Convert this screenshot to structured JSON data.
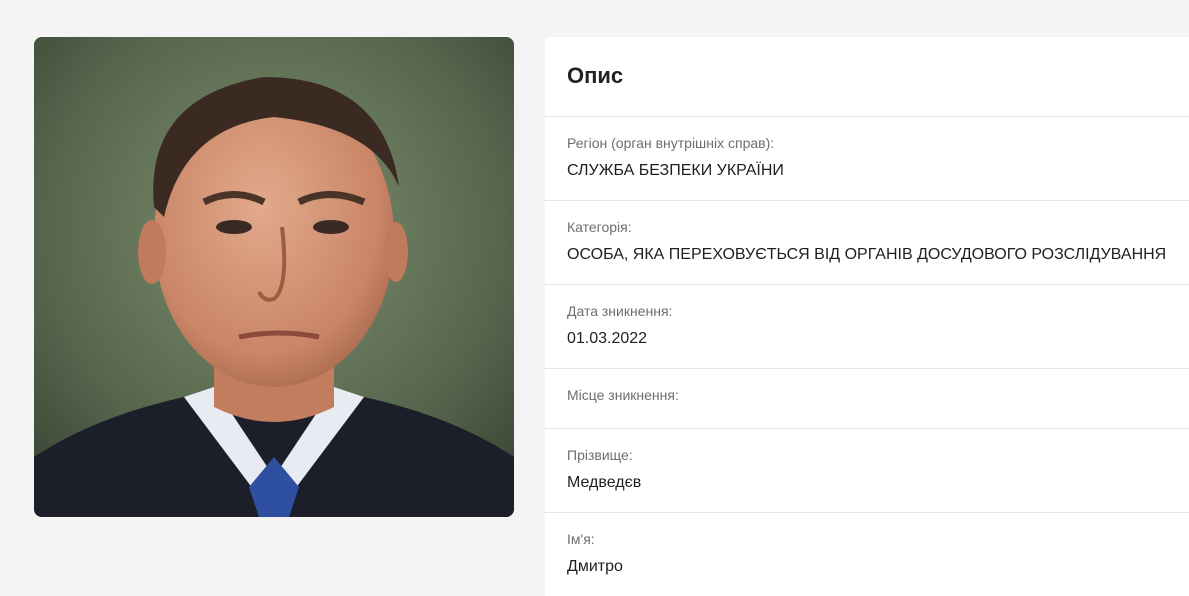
{
  "photo": {
    "description_icon": "person-portrait-photo"
  },
  "details": {
    "title": "Опис",
    "fields": [
      {
        "label": "Регіон (орган внутрішніх справ):",
        "value": "СЛУЖБА БЕЗПЕКИ УКРАЇНИ"
      },
      {
        "label": "Категорія:",
        "value": "ОСОБА, ЯКА ПЕРЕХОВУЄТЬСЯ ВІД ОРГАНІВ ДОСУДОВОГО РОЗСЛІДУВАННЯ"
      },
      {
        "label": "Дата зникнення:",
        "value": "01.03.2022"
      },
      {
        "label": "Місце зникнення:",
        "value": ""
      },
      {
        "label": "Прізвище:",
        "value": "Медведєв"
      },
      {
        "label": "Ім'я:",
        "value": "Дмитро"
      }
    ]
  }
}
